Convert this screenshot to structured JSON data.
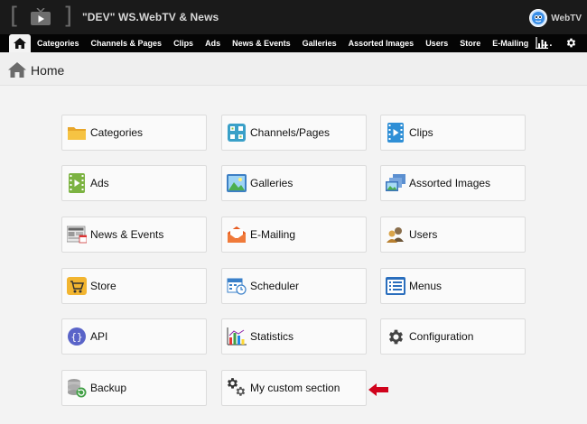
{
  "header": {
    "title": "\"DEV\" WS.WebTV & News",
    "brand": "WebTV",
    "logo_icon": "tv-play-icon",
    "brand_icon": "mascot-avatar-icon"
  },
  "nav": {
    "home_icon": "home-icon",
    "items": [
      "Categories",
      "Channels & Pages",
      "Clips",
      "Ads",
      "News & Events",
      "Galleries",
      "Assorted Images",
      "Users",
      "Store",
      "E-Mailing"
    ],
    "more": "...",
    "stats_icon": "statistics-icon",
    "settings_icon": "gear-icon"
  },
  "breadcrumb": {
    "title": "Home"
  },
  "tiles": [
    {
      "label": "Categories",
      "icon": "folder-icon"
    },
    {
      "label": "Channels/Pages",
      "icon": "channels-grid-icon"
    },
    {
      "label": "Clips",
      "icon": "clip-film-icon"
    },
    {
      "label": "Ads",
      "icon": "ads-film-icon"
    },
    {
      "label": "Galleries",
      "icon": "landscape-picture-icon"
    },
    {
      "label": "Assorted Images",
      "icon": "stacked-pictures-icon"
    },
    {
      "label": "News & Events",
      "icon": "newspaper-icon"
    },
    {
      "label": "E-Mailing",
      "icon": "envelope-icon"
    },
    {
      "label": "Users",
      "icon": "users-icon"
    },
    {
      "label": "Store",
      "icon": "shopping-cart-icon"
    },
    {
      "label": "Scheduler",
      "icon": "calendar-clock-icon"
    },
    {
      "label": "Menus",
      "icon": "menu-list-icon"
    },
    {
      "label": "API",
      "icon": "braces-icon"
    },
    {
      "label": "Statistics",
      "icon": "bar-chart-icon"
    },
    {
      "label": "Configuration",
      "icon": "cog-icon"
    },
    {
      "label": "Backup",
      "icon": "database-backup-icon"
    },
    {
      "label": "My custom section",
      "icon": "gears-icon"
    }
  ],
  "annotation": {
    "arrow_color": "#d0021b",
    "icon": "red-arrow-left-icon"
  },
  "colors": {
    "topbar": "#1a1a1a",
    "navbar": "#050505",
    "background": "#f3f3f3",
    "tile_border": "#dcdcdc"
  }
}
